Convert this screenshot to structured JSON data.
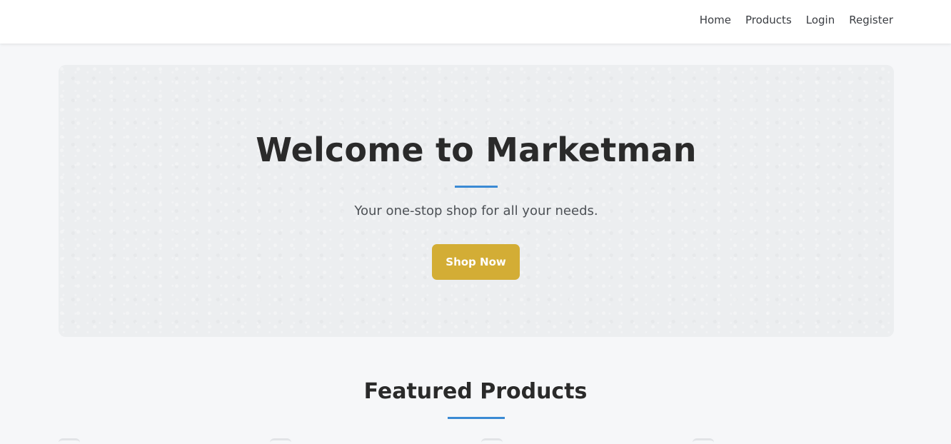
{
  "nav": {
    "links": [
      "Home",
      "Products",
      "Login",
      "Register"
    ]
  },
  "hero": {
    "title": "Welcome to Marketman",
    "subtitle": "Your one-stop shop for all your needs.",
    "cta_label": "Shop Now"
  },
  "featured": {
    "title": "Featured Products"
  },
  "colors": {
    "accent_blue": "#3a8ad4",
    "cta_gold": "#d3ad35",
    "hero_bg": "#eceef0",
    "page_bg": "#f6f7f9"
  }
}
